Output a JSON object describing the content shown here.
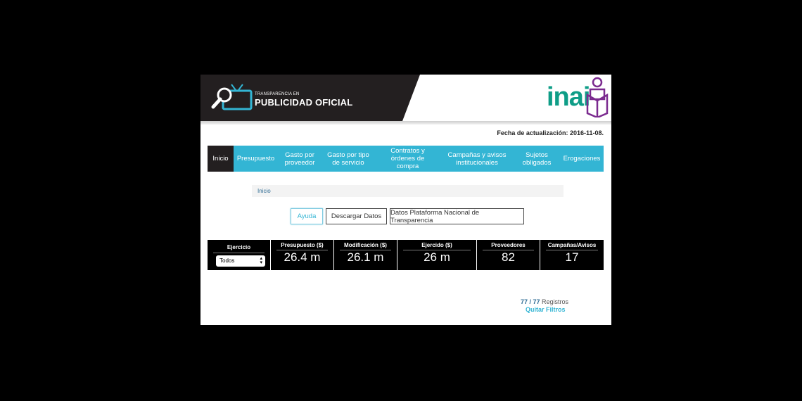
{
  "header": {
    "logo_small": "TRANSPARENCIA EN",
    "logo_big": "PUBLICIDAD OFICIAL",
    "brand": "inai"
  },
  "update": {
    "label": "Fecha de actualización:",
    "date": "2016-11-08."
  },
  "nav": [
    {
      "label": "Inicio",
      "active": true
    },
    {
      "label": "Presupuesto"
    },
    {
      "label": "Gasto por proveedor"
    },
    {
      "label": "Gasto por tipo de servicio"
    },
    {
      "label": "Contratos y órdenes de compra"
    },
    {
      "label": "Campañas y avisos institucionales"
    },
    {
      "label": "Sujetos obligados"
    },
    {
      "label": "Erogaciones"
    }
  ],
  "breadcrumb": "Inicio",
  "buttons": {
    "help": "Ayuda",
    "download": "Descargar Datos",
    "platform": "Datos Plataforma Nacional de Transparencia"
  },
  "stats": {
    "ejercicio_label": "Ejercicio",
    "ejercicio_value": "Todos",
    "presupuesto_label": "Presupuesto ($)",
    "presupuesto_value": "26.4 m",
    "modificacion_label": "Modificación ($)",
    "modificacion_value": "26.1 m",
    "ejercido_label": "Ejercido ($)",
    "ejercido_value": "26 m",
    "proveedores_label": "Proveedores",
    "proveedores_value": "82",
    "campanas_label": "Campañas/Avisos",
    "campanas_value": "17"
  },
  "records": {
    "shown": "77",
    "sep": " / ",
    "total": "77",
    "label": " Registros",
    "clear": "Quitar Filtros"
  },
  "colors": {
    "accent": "#33b5d4",
    "dark": "#231f20",
    "brand": "#0e9d87",
    "brand_purple": "#7b2a8f"
  }
}
